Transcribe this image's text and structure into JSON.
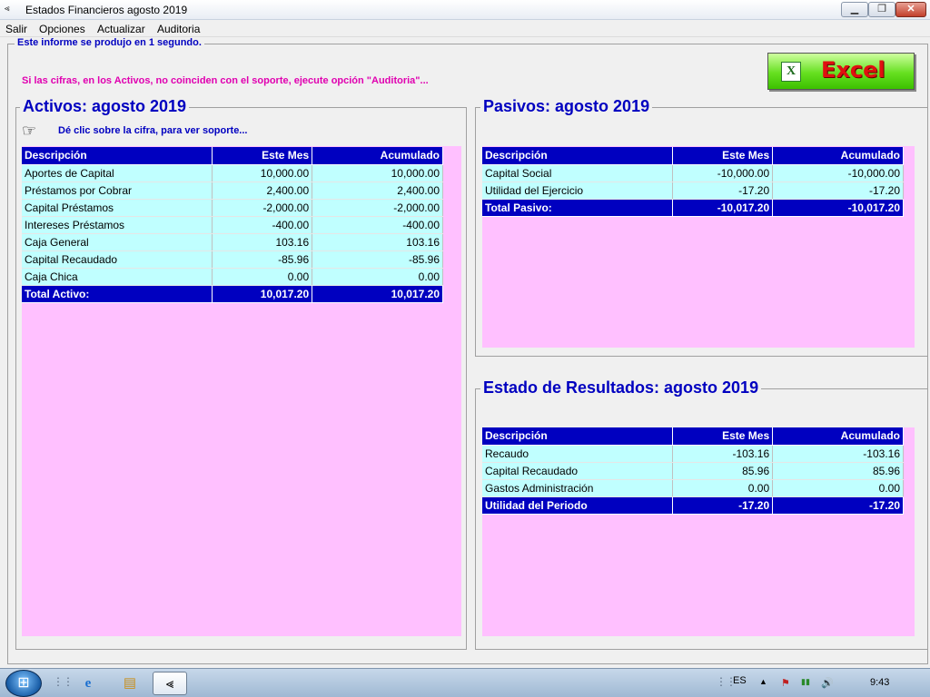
{
  "window": {
    "title": "Estados Financieros agosto 2019",
    "app_icon": "⪡",
    "buttons": {
      "minimize": "▁",
      "maximize": "❐",
      "close": "✕"
    }
  },
  "menu": [
    "Salir",
    "Opciones",
    "Actualizar",
    "Auditoria"
  ],
  "report_info": "Este informe se produjo en 1 segundo.",
  "warning": "Si las cifras, en los Activos, no coinciden con el soporte, ejecute opción \"Auditoria\"...",
  "excel_button": {
    "label": "Excel",
    "icon": "X"
  },
  "activos": {
    "title": "Activos: agosto 2019",
    "hint": "Dé clic sobre la cifra, para ver soporte...",
    "hint_icon": "☞",
    "headers": [
      "Descripción",
      "Este Mes",
      "Acumulado"
    ],
    "rows": [
      [
        "Aportes de Capital",
        "10,000.00",
        "10,000.00"
      ],
      [
        "Préstamos por Cobrar",
        "2,400.00",
        "2,400.00"
      ],
      [
        "Capital Préstamos",
        "-2,000.00",
        "-2,000.00"
      ],
      [
        "Intereses Préstamos",
        "-400.00",
        "-400.00"
      ],
      [
        "Caja General",
        "103.16",
        "103.16"
      ],
      [
        "Capital Recaudado",
        "-85.96",
        "-85.96"
      ],
      [
        "Caja Chica",
        "0.00",
        "0.00"
      ]
    ],
    "total": [
      "Total Activo:",
      "10,017.20",
      "10,017.20"
    ]
  },
  "pasivos": {
    "title": "Pasivos: agosto 2019",
    "headers": [
      "Descripción",
      "Este Mes",
      "Acumulado"
    ],
    "rows": [
      [
        "Capital Social",
        "-10,000.00",
        "-10,000.00"
      ],
      [
        "Utilidad del Ejercicio",
        "-17.20",
        "-17.20"
      ]
    ],
    "total": [
      "Total Pasivo:",
      "-10,017.20",
      "-10,017.20"
    ]
  },
  "resultados": {
    "title": "Estado de Resultados: agosto 2019",
    "headers": [
      "Descripción",
      "Este Mes",
      "Acumulado"
    ],
    "rows": [
      [
        "Recaudo",
        "-103.16",
        "-103.16"
      ],
      [
        "Capital Recaudado",
        "85.96",
        "85.96"
      ],
      [
        "Gastos Administración",
        "0.00",
        "0.00"
      ]
    ],
    "total": [
      "Utilidad del Periodo",
      "-17.20",
      "-17.20"
    ]
  },
  "taskbar": {
    "start_icon": "⊞",
    "apps": [
      "e",
      "▤",
      "⪡"
    ],
    "language": "ES",
    "tray_icons": [
      "▲",
      "⚑",
      "▮▮",
      "🔊"
    ],
    "time": "9:43"
  }
}
